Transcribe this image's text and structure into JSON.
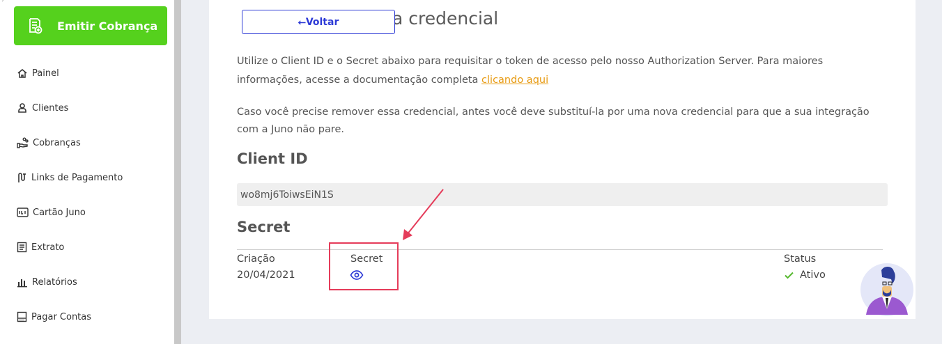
{
  "sidebar": {
    "emit_button": "Emitir Cobrança",
    "items": [
      {
        "label": "Painel",
        "icon": "home-icon"
      },
      {
        "label": "Clientes",
        "icon": "user-icon"
      },
      {
        "label": "Cobranças",
        "icon": "hand-coins-icon"
      },
      {
        "label": "Links de Pagamento",
        "icon": "link-icon"
      },
      {
        "label": "Cartão Juno",
        "icon": "card-icon"
      },
      {
        "label": "Extrato",
        "icon": "statement-icon"
      },
      {
        "label": "Relatórios",
        "icon": "bar-chart-icon"
      },
      {
        "label": "Pagar Contas",
        "icon": "barcode-icon"
      }
    ]
  },
  "main": {
    "title_fragment": "a credencial",
    "back_button": "⭠Voltar",
    "para1_text": "Utilize o Client ID e o Secret abaixo para requisitar o token de acesso pelo nosso Authorization Server. Para maiores informações, acesse a documentação completa ",
    "para1_link": "clicando aqui",
    "para2": "Caso você precise remover essa credencial, antes você deve substituí-la por uma nova credencial para que a sua integração com a Juno não pare.",
    "client_id_title": "Client ID",
    "client_id_value": "wo8mj6ToiwsEiN1S",
    "secret_title": "Secret",
    "table": {
      "created_header": "Criação",
      "created_value": "20/04/2021",
      "secret_header": "Secret",
      "status_header": "Status",
      "status_value": "Ativo"
    }
  },
  "colors": {
    "accent_green": "#55d11d",
    "link_orange": "#e79a11",
    "primary_blue": "#2d3ad6",
    "annotation_red": "#e53c5a"
  }
}
